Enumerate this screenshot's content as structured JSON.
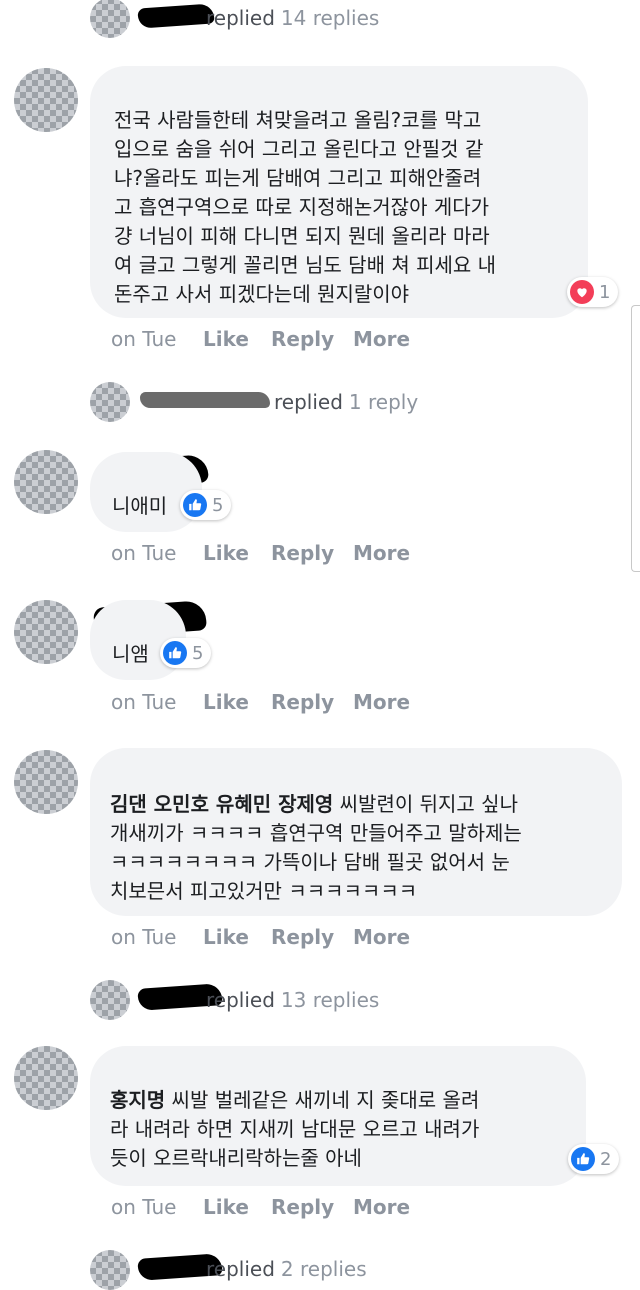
{
  "threads": [
    {
      "replier": "replied",
      "count": "14 replies"
    },
    {
      "replier": "replied",
      "count": "1 reply"
    },
    {
      "replier": "replied",
      "count": "13 replies"
    },
    {
      "replier": "replied",
      "count": "2 replies"
    }
  ],
  "comments": [
    {
      "text": "전국 사람들한테 쳐맞을려고 올림?코를 막고\n입으로 숨을 쉬어 그리고 올린다고 안필것 같\n냐?올라도 피는게 담배여 그리고 피해안줄려\n고 흡연구역으로 따로 지정해논거잖아 게다가\n걍 너님이 피해 다니면 되지 뭔데 올리라 마라\n여 글고 그렇게 꼴리면 님도 담배 쳐 피세요 내\n돈주고 사서 피겠다는데 뭔지랄이야",
      "reaction_count": "1",
      "time": "on Tue"
    },
    {
      "text": "니애미",
      "reaction_count": "5",
      "time": "on Tue"
    },
    {
      "text": "니앰",
      "reaction_count": "5",
      "time": "on Tue"
    },
    {
      "mentions": "김댄 오민호 유혜민 장제영",
      "text": " 씨발련이 뒤지고 싶나\n개새끼가 ㅋㅋㅋㅋ 흡연구역 만들어주고 말하제는\nㅋㅋㅋㅋㅋㅋㅋㅋ 가뜩이나 담배 필곳 없어서 눈\n치보믄서 피고있거만 ㅋㅋㅋㅋㅋㅋㅋ",
      "time": "on Tue"
    },
    {
      "mentions": "홍지명",
      "text": " 씨발 벌레같은 새끼네 지 좆대로 올려\n라 내려라 하면 지새끼 남대문 오르고 내려가\n듯이 오르락내리락하는줄 아네",
      "reaction_count": "2",
      "time": "on Tue"
    }
  ],
  "actions": {
    "like": "Like",
    "reply": "Reply",
    "more": "More"
  },
  "colors": {
    "bubble": "#f2f3f5",
    "like_blue": "#1877f2",
    "heart_red": "#f33e58",
    "meta_gray": "#8d949e"
  }
}
